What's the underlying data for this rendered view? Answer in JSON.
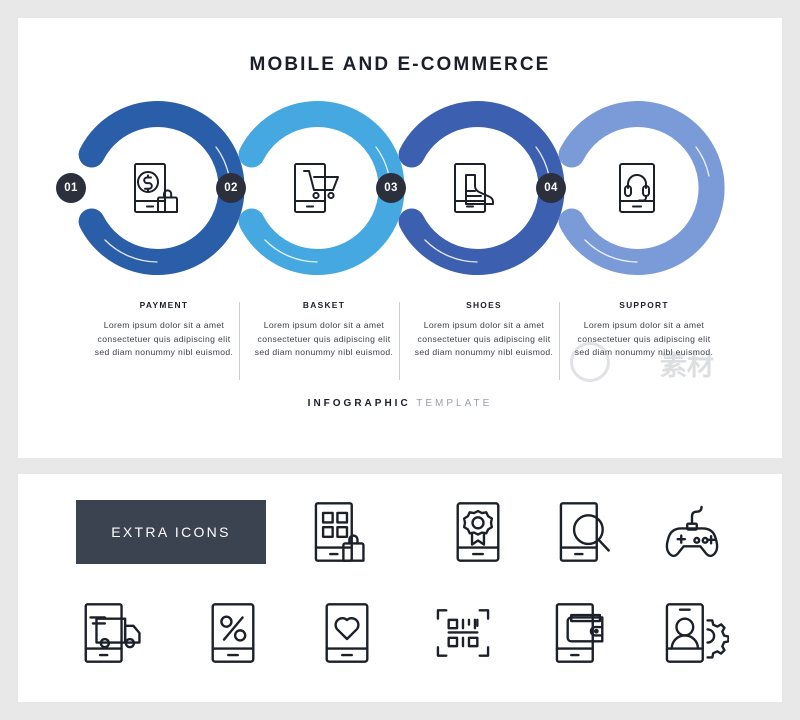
{
  "title": "MOBILE AND E-COMMERCE",
  "footer": {
    "bold": "INFOGRAPHIC",
    "light": "TEMPLATE"
  },
  "colors": {
    "background": "#e8e8e8",
    "panel": "#ffffff",
    "badge": "#2b303c",
    "ring_1": "#2b5ea8",
    "ring_2": "#45a8e0",
    "ring_3": "#3d5faf",
    "ring_4": "#7b9bd8",
    "stroke": "#1b2029",
    "extra_label_bg": "#3b4250",
    "divider": "#c9ccd2",
    "body_text": "#3a3f4a"
  },
  "steps": [
    {
      "number": "01",
      "label": "PAYMENT",
      "body": "Lorem ipsum dolor sit a amet consectetuer quis adipiscing elit sed diam nonummy nibl euismod.",
      "icon": "phone-dollar-coin-shopping-bag-icon",
      "ring_color": "#2b5ea8"
    },
    {
      "number": "02",
      "label": "BASKET",
      "body": "Lorem ipsum dolor sit a amet consectetuer quis adipiscing elit sed diam nonummy nibl euismod.",
      "icon": "phone-shopping-cart-icon",
      "ring_color": "#45a8e0"
    },
    {
      "number": "03",
      "label": "SHOES",
      "body": "Lorem ipsum dolor sit a amet consectetuer quis adipiscing elit sed diam nonummy nibl euismod.",
      "icon": "phone-boot-shoe-icon",
      "ring_color": "#3d5faf"
    },
    {
      "number": "04",
      "label": "SUPPORT",
      "body": "Lorem ipsum dolor sit a amet consectetuer quis adipiscing elit sed diam nonummy nibl euismod.",
      "icon": "phone-headset-icon",
      "ring_color": "#7b9bd8"
    }
  ],
  "extra_icons": {
    "label": "EXTRA ICONS",
    "items": [
      {
        "name": "phone-product-grid-shopping-bag-icon"
      },
      {
        "name": "phone-award-ribbon-icon"
      },
      {
        "name": "phone-magnifier-search-icon"
      },
      {
        "name": "game-controller-icon"
      },
      {
        "name": "phone-delivery-truck-icon"
      },
      {
        "name": "phone-percent-discount-icon"
      },
      {
        "name": "phone-heart-favorite-icon"
      },
      {
        "name": "qr-code-scan-icon"
      },
      {
        "name": "phone-wallet-icon"
      },
      {
        "name": "phone-user-gear-settings-icon"
      }
    ]
  },
  "watermark": {
    "text": "素材"
  }
}
